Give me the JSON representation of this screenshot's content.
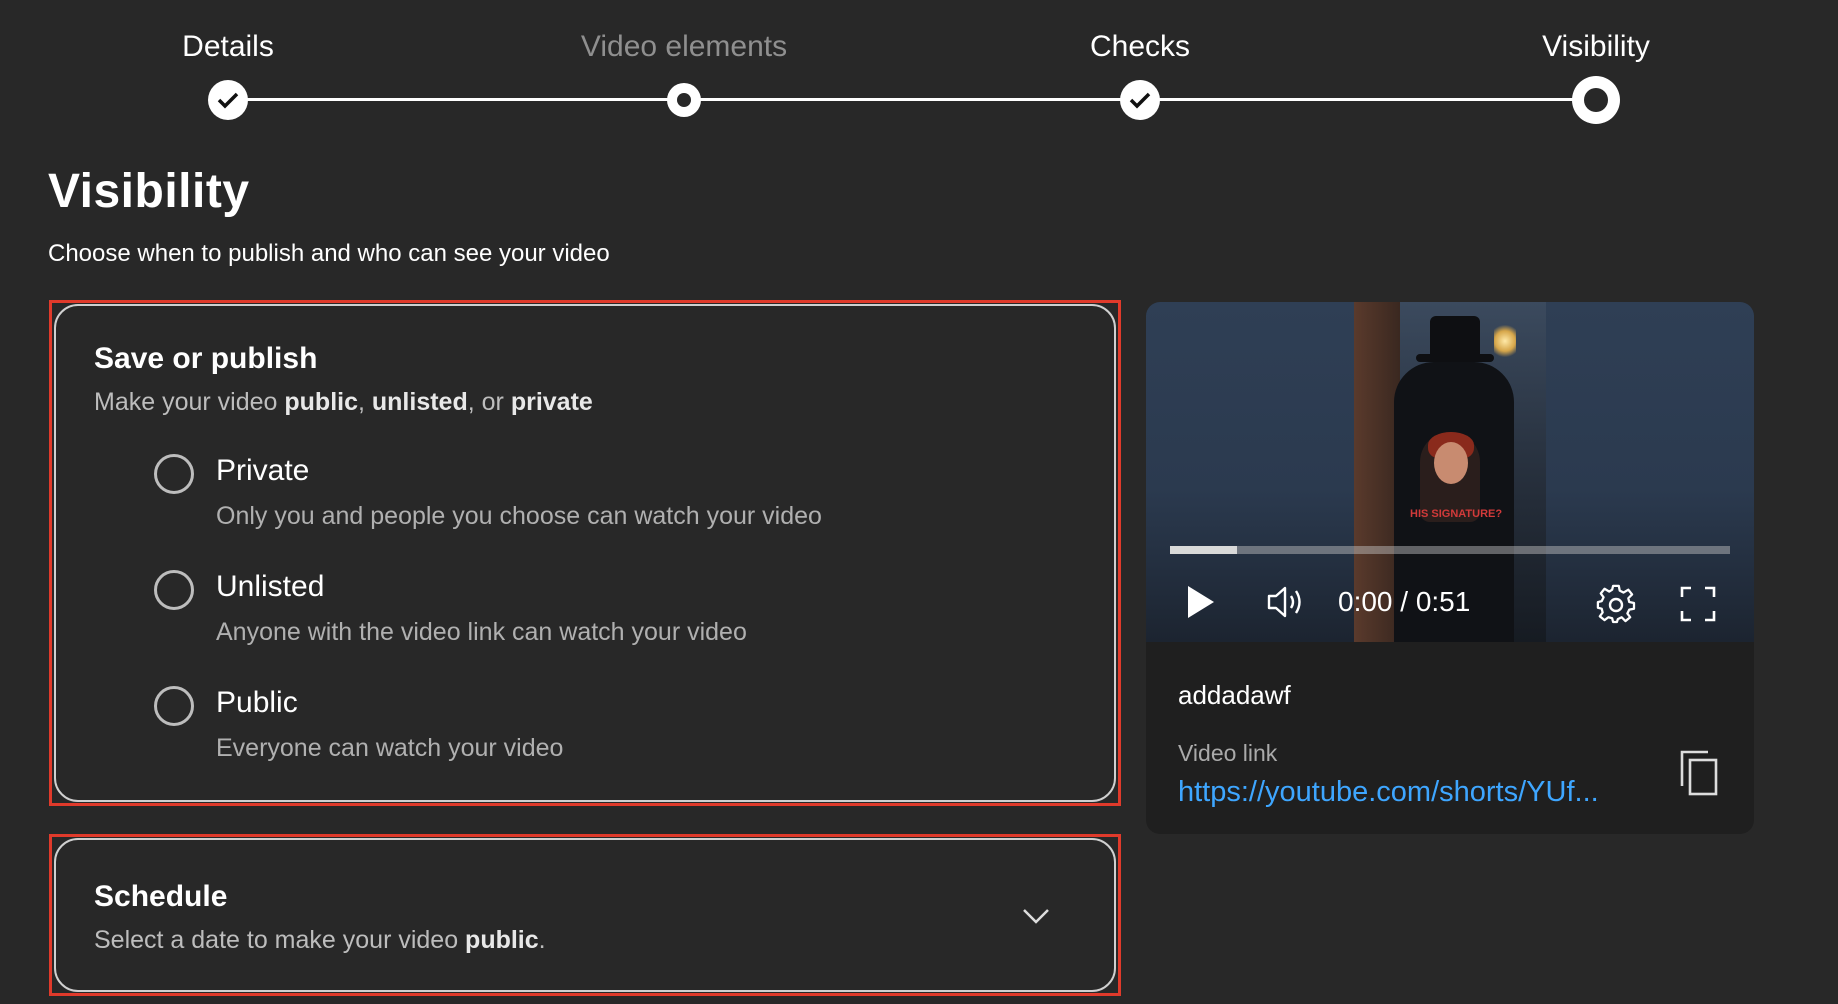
{
  "stepper": {
    "steps": [
      {
        "label": "Details",
        "state": "done"
      },
      {
        "label": "Video elements",
        "state": "inactive"
      },
      {
        "label": "Checks",
        "state": "done"
      },
      {
        "label": "Visibility",
        "state": "current"
      }
    ]
  },
  "page": {
    "title": "Visibility",
    "subtitle": "Choose when to publish and who can see your video"
  },
  "save_publish": {
    "title": "Save or publish",
    "subtitle_prefix": "Make your video ",
    "subtitle_public": "public",
    "subtitle_sep1": ", ",
    "subtitle_unlisted": "unlisted",
    "subtitle_sep2": ", or ",
    "subtitle_private": "private",
    "options": [
      {
        "label": "Private",
        "desc": "Only you and people you choose can watch your video"
      },
      {
        "label": "Unlisted",
        "desc": "Anyone with the video link can watch your video"
      },
      {
        "label": "Public",
        "desc": "Everyone can watch your video"
      }
    ]
  },
  "schedule": {
    "title": "Schedule",
    "subtitle_prefix": "Select a date to make your video ",
    "subtitle_bold": "public",
    "subtitle_suffix": "."
  },
  "preview": {
    "time": "0:00 / 0:51",
    "progress": 0.12,
    "thumbnail_text": "HIS SIGNATURE?",
    "channel": "addadawf",
    "link_label": "Video link",
    "link_url": "https://youtube.com/shorts/YUf..."
  },
  "colors": {
    "background": "#282828",
    "highlight": "#e03a2b",
    "link": "#3ea6ff"
  },
  "icons": [
    "check-icon",
    "play-icon",
    "volume-icon",
    "gear-icon",
    "fullscreen-icon",
    "copy-icon",
    "chevron-down-icon"
  ]
}
